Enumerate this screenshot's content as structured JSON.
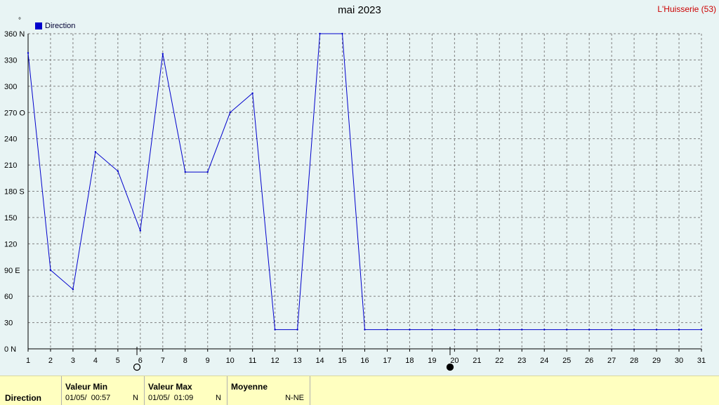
{
  "header": {
    "title": "mai 2023",
    "station": "L'Huisserie (53)",
    "unit": "°",
    "legend_label": "Direction"
  },
  "colors": {
    "series": "#0000cc",
    "station_text": "#cc0000",
    "footer_bg": "#ffffc0",
    "plot_bg": "#e8f4f4"
  },
  "chart_data": {
    "type": "line",
    "title": "mai 2023",
    "ylabel": "°",
    "xlabel": "",
    "ylim": [
      0,
      360
    ],
    "xlim": [
      1,
      31
    ],
    "grid": true,
    "legend": "top-left",
    "y_ticks": [
      "0 N",
      "30",
      "60",
      "90 E",
      "120",
      "150",
      "180 S",
      "210",
      "240",
      "270 O",
      "300",
      "330",
      "360 N"
    ],
    "y_tick_values": [
      0,
      30,
      60,
      90,
      120,
      150,
      180,
      210,
      240,
      270,
      300,
      330,
      360
    ],
    "x_ticks": [
      "1",
      "2",
      "3",
      "4",
      "5",
      "6",
      "7",
      "8",
      "9",
      "10",
      "11",
      "12",
      "13",
      "14",
      "15",
      "16",
      "17",
      "18",
      "19",
      "20",
      "21",
      "22",
      "23",
      "24",
      "25",
      "26",
      "27",
      "28",
      "29",
      "30",
      "31"
    ],
    "moon_phases": [
      {
        "day": 5.85,
        "symbol": "new-moon"
      },
      {
        "day": 19.8,
        "symbol": "full-moon"
      }
    ],
    "series": [
      {
        "name": "Direction",
        "x": [
          1,
          2,
          3,
          4,
          5,
          6,
          7,
          8,
          9,
          10,
          11,
          12,
          13,
          14,
          15,
          16,
          17,
          18,
          19,
          20,
          21,
          22,
          23,
          24,
          25,
          26,
          27,
          28,
          29,
          30,
          31
        ],
        "y": [
          338,
          90,
          68,
          225,
          203,
          135,
          337,
          202,
          202,
          270,
          292,
          22,
          22,
          360,
          360,
          22,
          22,
          22,
          22,
          22,
          22,
          22,
          22,
          22,
          22,
          22,
          22,
          22,
          22,
          22,
          22
        ]
      }
    ]
  },
  "footer": {
    "row_label": "Direction",
    "min": {
      "header": "Valeur Min",
      "date": "01/05/  00:57",
      "dir": "N"
    },
    "max": {
      "header": "Valeur Max",
      "date": "01/05/  01:09",
      "dir": "N"
    },
    "avg": {
      "header": "Moyenne",
      "value": "N-NE"
    }
  }
}
